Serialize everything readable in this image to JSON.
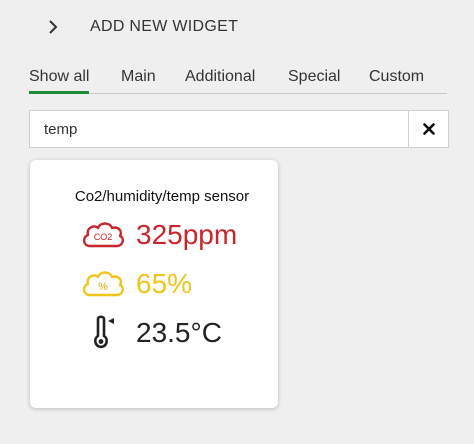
{
  "header": {
    "title": "ADD NEW WIDGET",
    "back_icon": "chevron-right-icon"
  },
  "tabs": [
    {
      "label": "Show all",
      "active": true
    },
    {
      "label": "Main",
      "active": false
    },
    {
      "label": "Additional",
      "active": false
    },
    {
      "label": "Special",
      "active": false
    },
    {
      "label": "Custom",
      "active": false
    }
  ],
  "search": {
    "value": "temp",
    "clear_icon": "close-icon"
  },
  "widget": {
    "title": "Co2/humidity/temp sensor",
    "readings": [
      {
        "icon": "co2-cloud-icon",
        "icon_text": "CO2",
        "value": "325ppm",
        "color": "#c8252c"
      },
      {
        "icon": "humidity-cloud-icon",
        "icon_text": "%",
        "value": "65%",
        "color": "#f0c419"
      },
      {
        "icon": "thermometer-icon",
        "value": "23.5°C",
        "color": "#222222"
      }
    ]
  },
  "colors": {
    "accent": "#1f8a36",
    "background": "#efefef"
  }
}
